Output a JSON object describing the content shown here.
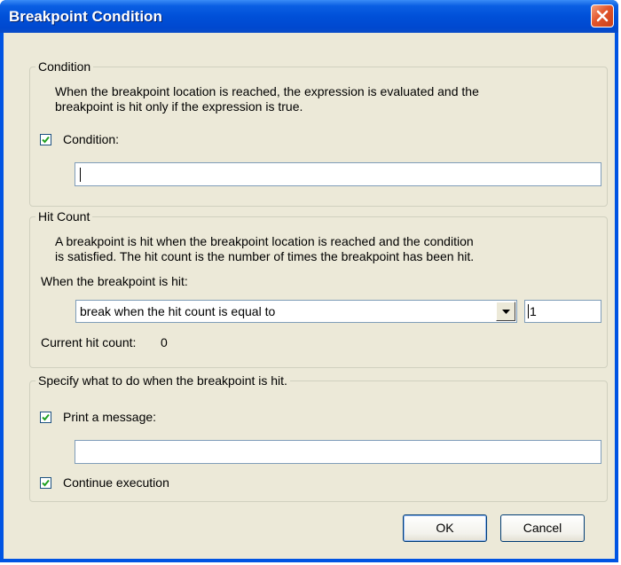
{
  "window": {
    "title": "Breakpoint Condition"
  },
  "condition_group": {
    "legend": "Condition",
    "description_line1": "When the breakpoint location is reached, the expression is evaluated and the",
    "description_line2": "breakpoint is hit only if the expression is true.",
    "checkbox_label": "Condition:",
    "checked": true,
    "expression_value": ""
  },
  "hit_count_group": {
    "legend": "Hit Count",
    "description_line1": "A breakpoint is hit when the breakpoint location is reached and the condition",
    "description_line2": "is satisfied. The hit count is the number of times the breakpoint has been hit.",
    "when_hit_label": "When the breakpoint is hit:",
    "selected_option": "break when the hit count is equal to",
    "count_value": "1",
    "current_label": "Current hit count:",
    "current_value": "0"
  },
  "action_group": {
    "legend": "Specify what to do when the breakpoint is hit.",
    "print_label": "Print a message:",
    "print_checked": true,
    "message_value": "",
    "continue_label": "Continue execution",
    "continue_checked": true
  },
  "buttons": {
    "ok": "OK",
    "cancel": "Cancel"
  },
  "colors": {
    "titlebar": "#0054e3",
    "client": "#ece9d8",
    "close": "#e2552b",
    "check": "#21a121"
  }
}
